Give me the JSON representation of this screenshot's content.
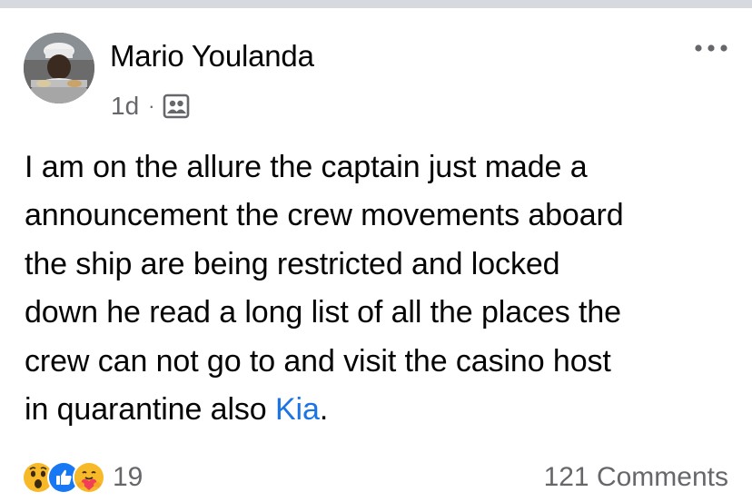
{
  "post": {
    "author_name": "Mario Youlanda",
    "time": "1d",
    "separator": "·",
    "audience_icon": "group-icon",
    "text_lines": [
      "I am on the allure the captain just made a",
      "announcement the crew movements aboard",
      "the ship are being restricted and locked",
      "down he read a long list of all the places the",
      "crew can not go to and visit the casino host",
      "in quarantine also "
    ],
    "mention": "Kia",
    "text_end": "."
  },
  "reactions": {
    "icons": [
      "wow-reaction-icon",
      "like-reaction-icon",
      "care-reaction-icon"
    ],
    "count": "19"
  },
  "comments": {
    "label": "121 Comments"
  },
  "colors": {
    "link": "#1b74e4",
    "secondary_text": "#65676b",
    "primary_text": "#050505",
    "like_blue": "#1877f2",
    "wow_yellow": "#f7b928"
  }
}
